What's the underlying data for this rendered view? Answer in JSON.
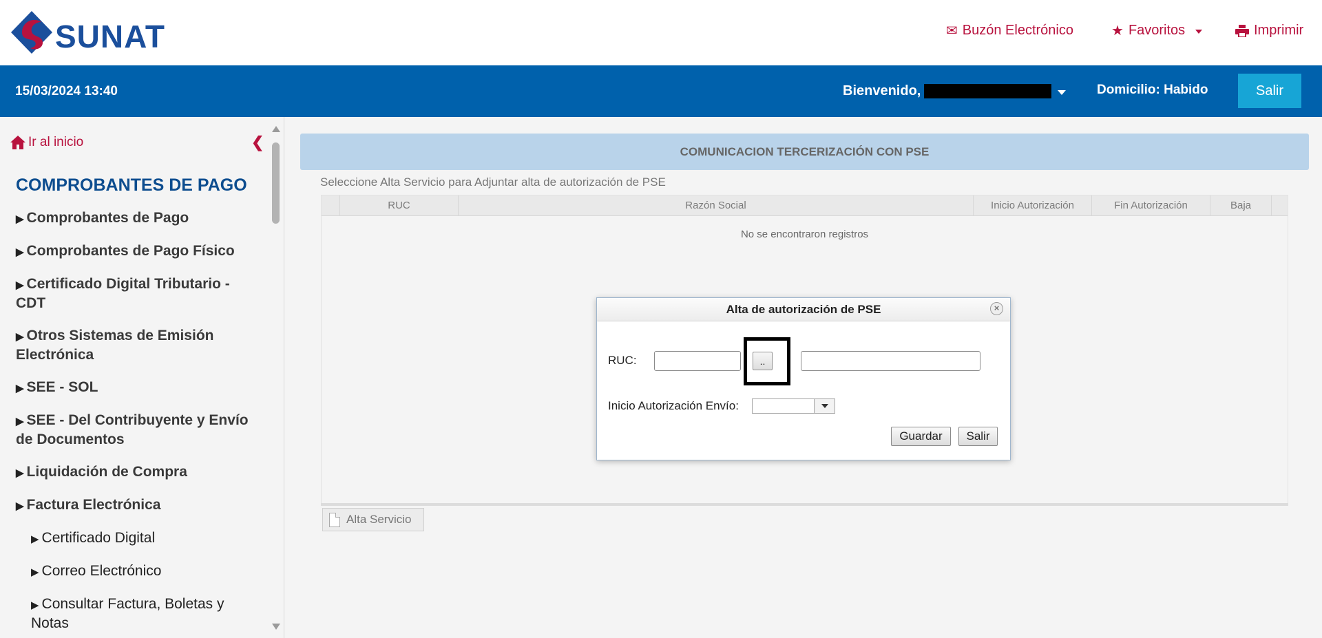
{
  "brand": {
    "logo_text": "SUNAT"
  },
  "top_nav": {
    "buzon_label": "Buzón Electrónico",
    "favoritos_label": "Favoritos",
    "imprimir_label": "Imprimir"
  },
  "bar": {
    "datetime": "15/03/2024 13:40",
    "welcome_label": "Bienvenido,",
    "domicilio": "Domicilio: Habido",
    "salir_label": "Salir"
  },
  "sidebar": {
    "home_label": "Ir al inicio",
    "section_title": "COMPROBANTES DE PAGO",
    "items": [
      {
        "label": "Comprobantes de Pago"
      },
      {
        "label": "Comprobantes de Pago Físico"
      },
      {
        "label": "Certificado Digital Tributario - CDT"
      },
      {
        "label": "Otros Sistemas de Emisión Electrónica"
      },
      {
        "label": "SEE - SOL"
      },
      {
        "label": "SEE - Del Contribuyente y Envío de Documentos"
      },
      {
        "label": "Liquidación de Compra"
      },
      {
        "label": "Factura Electrónica"
      }
    ],
    "subitems": [
      {
        "label": "Certificado Digital"
      },
      {
        "label": "Correo Electrónico"
      },
      {
        "label": "Consultar Factura, Boletas y Notas"
      }
    ]
  },
  "main": {
    "header": "COMUNICACION TERCERIZACIÓN CON PSE",
    "instruction": "Seleccione Alta Servicio para Adjuntar alta de autorización de PSE",
    "columns": [
      "RUC",
      "Razón Social",
      "Inicio Autorización",
      "Fin Autorización",
      "Baja"
    ],
    "empty_message": "No se encontraron registros",
    "alta_button": "Alta Servicio"
  },
  "dialog": {
    "title": "Alta de autorización de PSE",
    "ruc_label": "RUC:",
    "ruc_value": "",
    "razon_value": "",
    "search_button": "..",
    "inicio_label": "Inicio Autorización Envío:",
    "inicio_value": "",
    "guardar_label": "Guardar",
    "salir_label": "Salir"
  },
  "colors": {
    "brand_red": "#b8123e",
    "brand_blue": "#0061ac",
    "salir_blue": "#17a5d6",
    "section_blue": "#0d4d8f",
    "header_panel": "#b9d3ea"
  },
  "icons": {
    "logo": "sunat-logo",
    "buzon": "envelope-icon",
    "favoritos": "star-icon",
    "imprimir": "printer-icon",
    "home": "home-icon",
    "collapse": "chevron-left-icon",
    "menu_bullet": "triangle-right-icon",
    "alta": "document-icon",
    "close": "close-icon"
  }
}
